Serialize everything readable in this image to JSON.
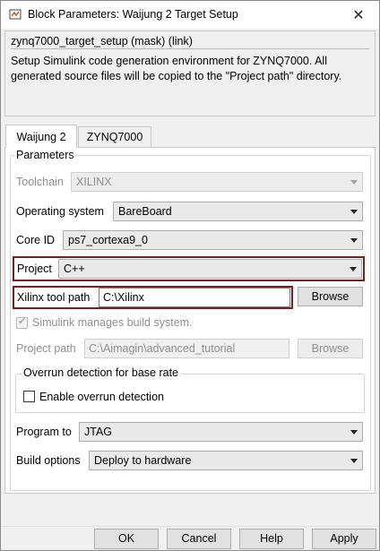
{
  "window": {
    "title": "Block Parameters: Waijung 2 Target Setup",
    "close_glyph": "✕"
  },
  "description": {
    "title": "zynq7000_target_setup (mask) (link)",
    "text": "Setup Simulink code generation environment for ZYNQ7000. All generated source files will be copied to the \"Project path\" directory."
  },
  "tabs": [
    {
      "label": "Waijung 2",
      "active": true
    },
    {
      "label": "ZYNQ7000",
      "active": false
    }
  ],
  "parameters": {
    "legend": "Parameters",
    "toolchain": {
      "label": "Toolchain",
      "value": "XILINX"
    },
    "os": {
      "label": "Operating system",
      "value": "BareBoard"
    },
    "core": {
      "label": "Core ID",
      "value": "ps7_cortexa9_0"
    },
    "project": {
      "label": "Project",
      "value": "C++"
    },
    "xilinx": {
      "label": "Xilinx tool path",
      "value": "C:\\Xilinx",
      "browse": "Browse"
    },
    "build_system": {
      "label": "Simulink manages build system.",
      "checked": true
    },
    "project_path": {
      "label": "Project path",
      "value": "C:\\Aimagin\\advanced_tutorial",
      "browse": "Browse"
    },
    "overrun": {
      "legend": "Overrun detection for base rate",
      "label": "Enable overrun detection",
      "checked": false
    },
    "program_to": {
      "label": "Program to",
      "value": "JTAG"
    },
    "build_options": {
      "label": "Build options",
      "value": "Deploy to hardware"
    }
  },
  "footer": {
    "ok": "OK",
    "cancel": "Cancel",
    "help": "Help",
    "apply": "Apply"
  },
  "colors": {
    "highlight": "#7a1f1f"
  }
}
